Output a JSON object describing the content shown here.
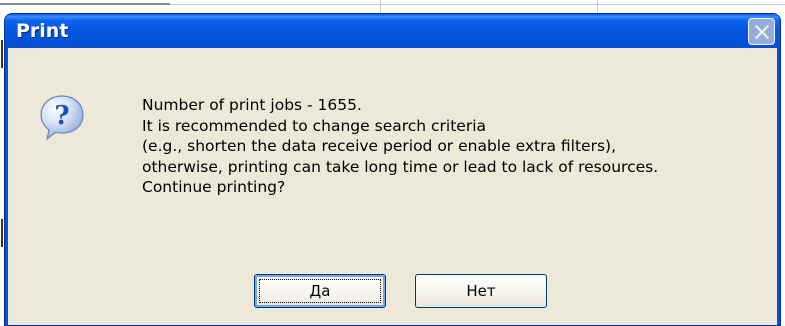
{
  "dialog": {
    "title": "Print",
    "message_lines": [
      "Number of print jobs - 1655.",
      "It is recommended to change search criteria",
      "(e.g., shorten the data receive period or enable extra filters),",
      "otherwise, printing can take long time or lead to lack of resources.",
      "Continue printing?"
    ],
    "buttons": {
      "yes_label": "Да",
      "no_label": "Нет"
    },
    "icon": "question-icon",
    "close_icon": "close-icon"
  },
  "colors": {
    "titlebar": "#0555e0",
    "client_bg": "#ece9d8",
    "button_border": "#003c74",
    "icon_blue": "#1e4fb8"
  }
}
